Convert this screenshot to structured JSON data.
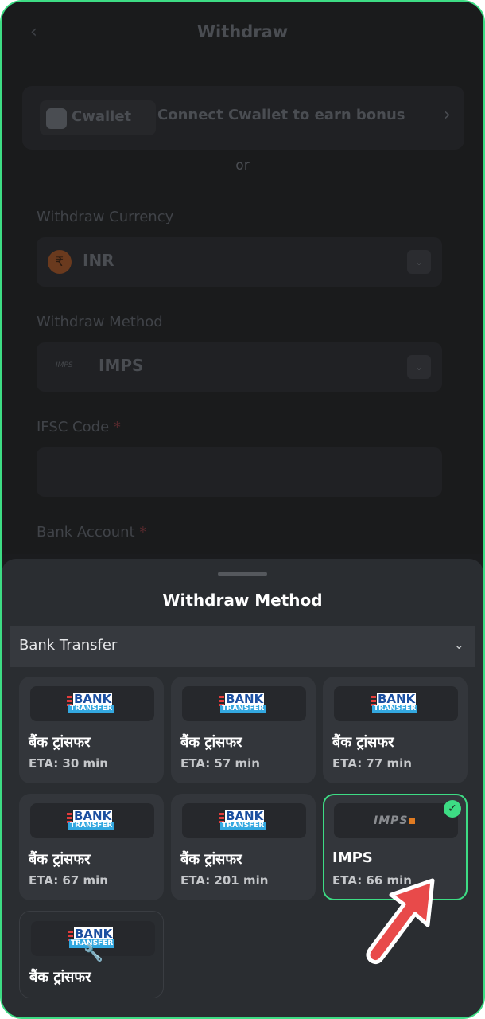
{
  "header": {
    "back_icon": "chevron-left-icon",
    "title": "Withdraw"
  },
  "cwallet": {
    "logo_text": "Cwallet",
    "text": "Connect Cwallet to earn bonus",
    "arrow_icon": "chevron-right-icon"
  },
  "or_text": "or",
  "form": {
    "currency_label": "Withdraw Currency",
    "currency_symbol": "₹",
    "currency_value": "INR",
    "method_label": "Withdraw Method",
    "method_logo_text": "IMPS",
    "method_value": "IMPS",
    "ifsc_label": "IFSC Code",
    "required_mark": "*",
    "bank_account_label": "Bank Account"
  },
  "sheet": {
    "title": "Withdraw Method",
    "category": "Bank Transfer",
    "bank_logo_top": "BANK",
    "bank_logo_bottom": "TRANSFER",
    "imps_logo": "IMPS",
    "methods": [
      {
        "name": "बैंक ट्रांसफर",
        "eta": "ETA: 30 min"
      },
      {
        "name": "बैंक ट्रांसफर",
        "eta": "ETA: 57 min"
      },
      {
        "name": "बैंक ट्रांसफर",
        "eta": "ETA: 77 min"
      },
      {
        "name": "बैंक ट्रांसफर",
        "eta": "ETA: 67 min"
      },
      {
        "name": "बैंक ट्रांसफर",
        "eta": "ETA: 201 min"
      },
      {
        "name": "IMPS",
        "eta": "ETA: 66 min",
        "selected": true
      },
      {
        "name": "बैंक ट्रांसफर",
        "eta": "",
        "maintenance": true
      }
    ]
  },
  "colors": {
    "accent": "#3ddc84",
    "pointer": "#e84a4a"
  }
}
